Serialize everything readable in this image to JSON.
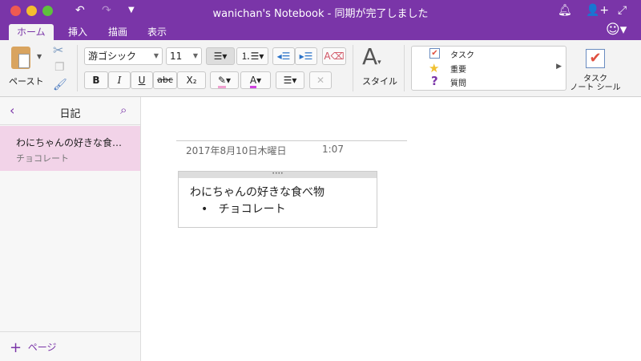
{
  "window": {
    "title": "wanichan's Notebook - 同期が完了しました"
  },
  "tabs": [
    {
      "label": "ホーム",
      "active": true
    },
    {
      "label": "挿入"
    },
    {
      "label": "描画"
    },
    {
      "label": "表示"
    }
  ],
  "ribbon": {
    "paste": "ペースト",
    "font": "游ゴシック",
    "size": "11",
    "bold": "B",
    "italic": "I",
    "underline": "U",
    "strike": "abc",
    "subscript": "X₂",
    "style": "スタイル",
    "tags": [
      {
        "label": "タスク",
        "icon": "checkbox-icon"
      },
      {
        "label": "重要",
        "icon": "star-icon"
      },
      {
        "label": "質問",
        "icon": "question-icon"
      }
    ],
    "todo_tag": "タスク",
    "todo_tag2": "ノート シール"
  },
  "colors": {
    "accent": "#7a35a8",
    "selected": "#f2d3e8",
    "highlight": "#f0a0d0",
    "font_color": "#d040e0"
  },
  "sidebar": {
    "title": "日記",
    "pages": [
      {
        "title": "わにちゃんの好きな食…",
        "preview": "チョコレート",
        "selected": true
      }
    ],
    "add_page": "ページ"
  },
  "page": {
    "date": "2017年8月10日木曜日",
    "time": "1:07",
    "note_title": "わにちゃんの好きな食べ物",
    "bullets": [
      "チョコレート"
    ]
  }
}
